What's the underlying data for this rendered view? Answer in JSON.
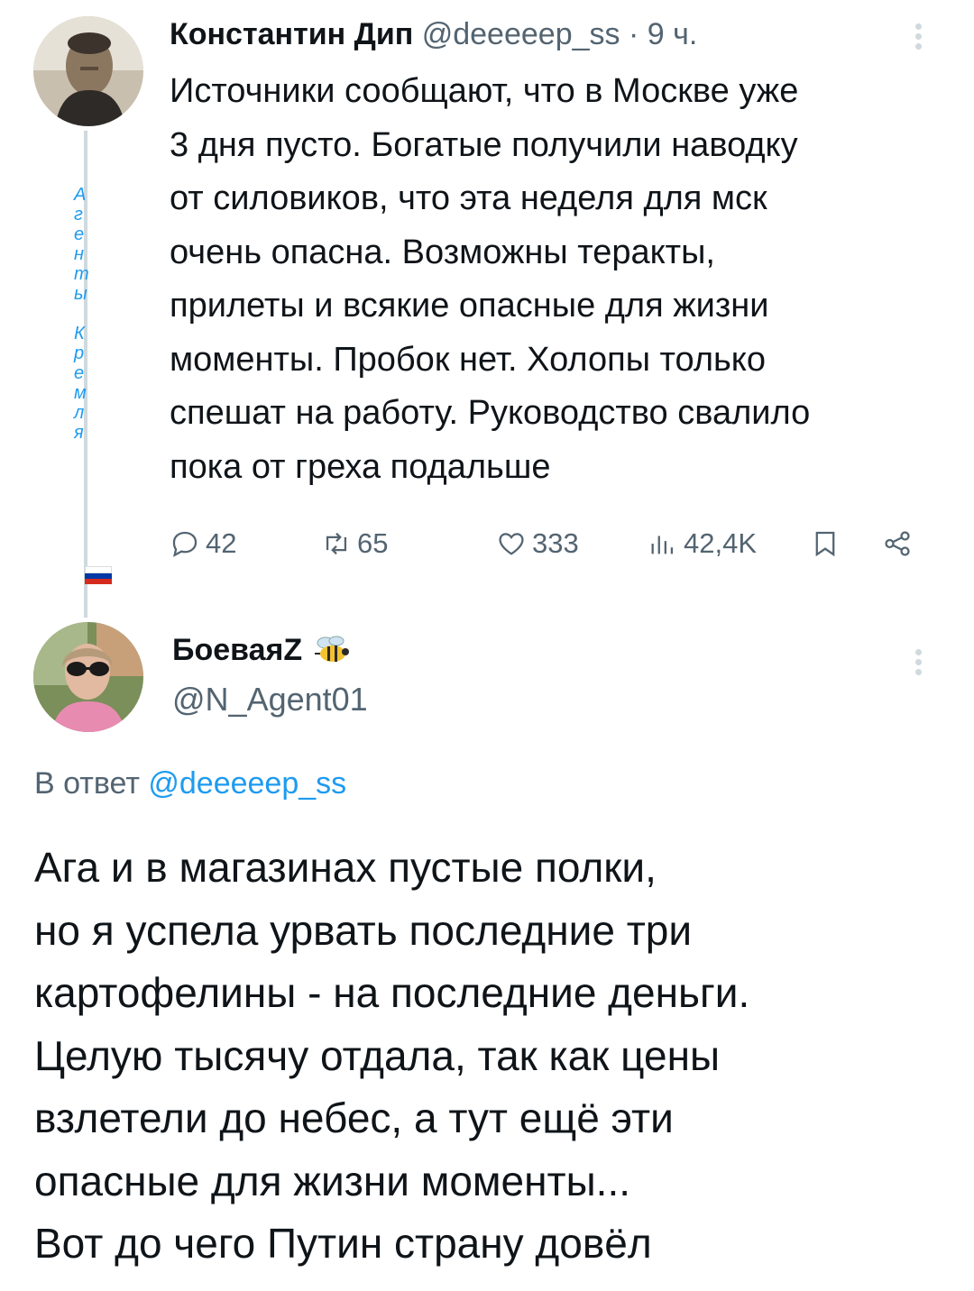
{
  "parent_tweet": {
    "display_name": "Константин Дип",
    "handle": "@deeeeep_ss",
    "separator": "·",
    "time": "9 ч.",
    "text": "Источники сообщают, что в Москве уже\n3 дня пусто. Богатые получили наводку\nот силовиков, что эта неделя для мск\nочень опасна. Возможны теракты,\nприлеты и всякие опасные для жизни\nмоменты. Пробок нет. Холопы только\nспешат на работу. Руководство свалило\nпока от греха подальше",
    "thread_label": "А\nг\nе\nн\nт\nы\n\nК\nр\nе\nм\nл\nя",
    "actions": {
      "replies": "42",
      "retweets": "65",
      "likes": "333",
      "views": "42,4K"
    },
    "icons": [
      "avatar",
      "more-vert-icon",
      "reply-icon",
      "retweet-icon",
      "heart-icon",
      "views-icon",
      "bookmark-icon",
      "share-icon",
      "russian-flag-icon"
    ]
  },
  "reply_tweet": {
    "display_name": "БоеваяZ",
    "handle": "@N_Agent01",
    "reply_to_prefix": "В ответ",
    "reply_to_handle": "@deeeeep_ss",
    "text": "Ага и в магазинах пустые полки,\nно я успела урвать последние три\nкартофелины - на последние деньги.\nЦелую тысячу отдала, так как цены\nвзлетели до небес, а тут ещё эти\nопасные для жизни моменты...\nВот до чего Путин страну довёл",
    "icons": [
      "avatar",
      "bee-icon",
      "more-vert-icon"
    ]
  },
  "colors": {
    "text": "#0f1419",
    "muted": "#536471",
    "link": "#1d9bf0",
    "thread_line": "#cfd9de",
    "flag": [
      "#ffffff",
      "#0039a6",
      "#d52b1e"
    ]
  }
}
